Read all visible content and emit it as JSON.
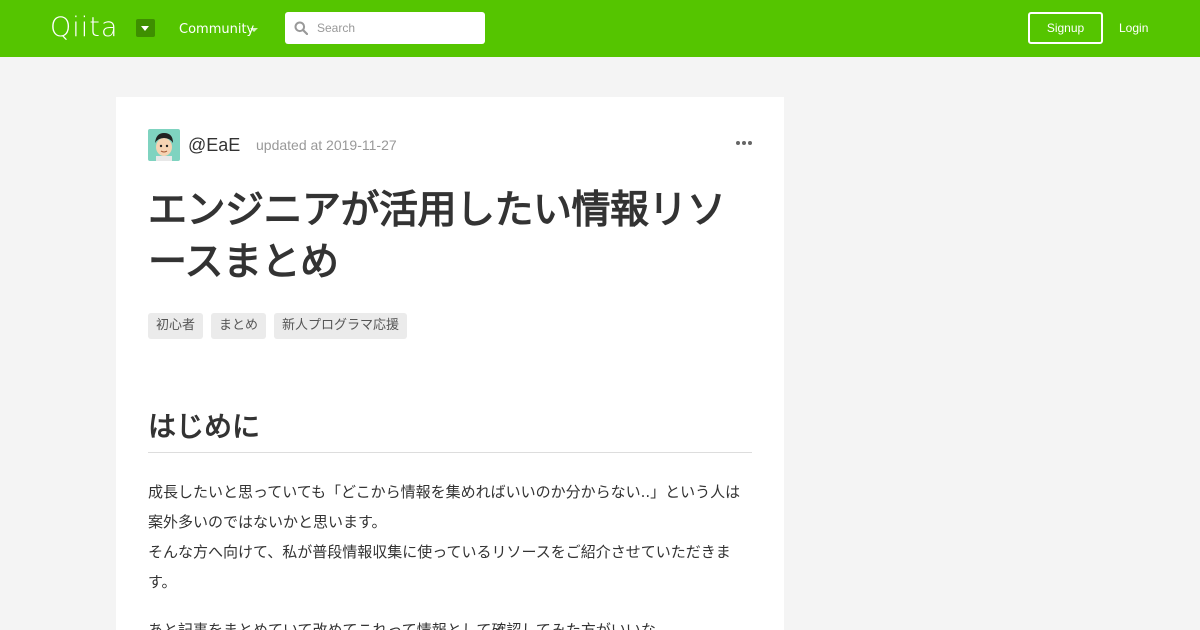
{
  "header": {
    "logo_text": "Qiita",
    "logo_menu_icon": "caret-down-icon",
    "community_label": "Community",
    "search": {
      "placeholder": "Search",
      "value": ""
    },
    "signup_label": "Signup",
    "login_label": "Login",
    "brand_color": "#55c500"
  },
  "article": {
    "author": "@EaE",
    "updated": "updated at 2019-11-27",
    "more_icon": "ellipsis-icon",
    "title": "エンジニアが活用したい情報リソースまとめ",
    "tags": [
      "初心者",
      "まとめ",
      "新人プログラマ応援"
    ],
    "section_heading": "はじめに",
    "paragraphs": [
      "成長したいと思っていても「どこから情報を集めればいいのか分からない..」という人は案外多いのではないかと思います。",
      "そんな方へ向けて、私が普段情報収集に使っているリソースをご紹介させていただきます。"
    ],
    "next_paragraph_partial": "あと記事をまとめていて改めてこれって情報として確認してみた方がいいな"
  }
}
